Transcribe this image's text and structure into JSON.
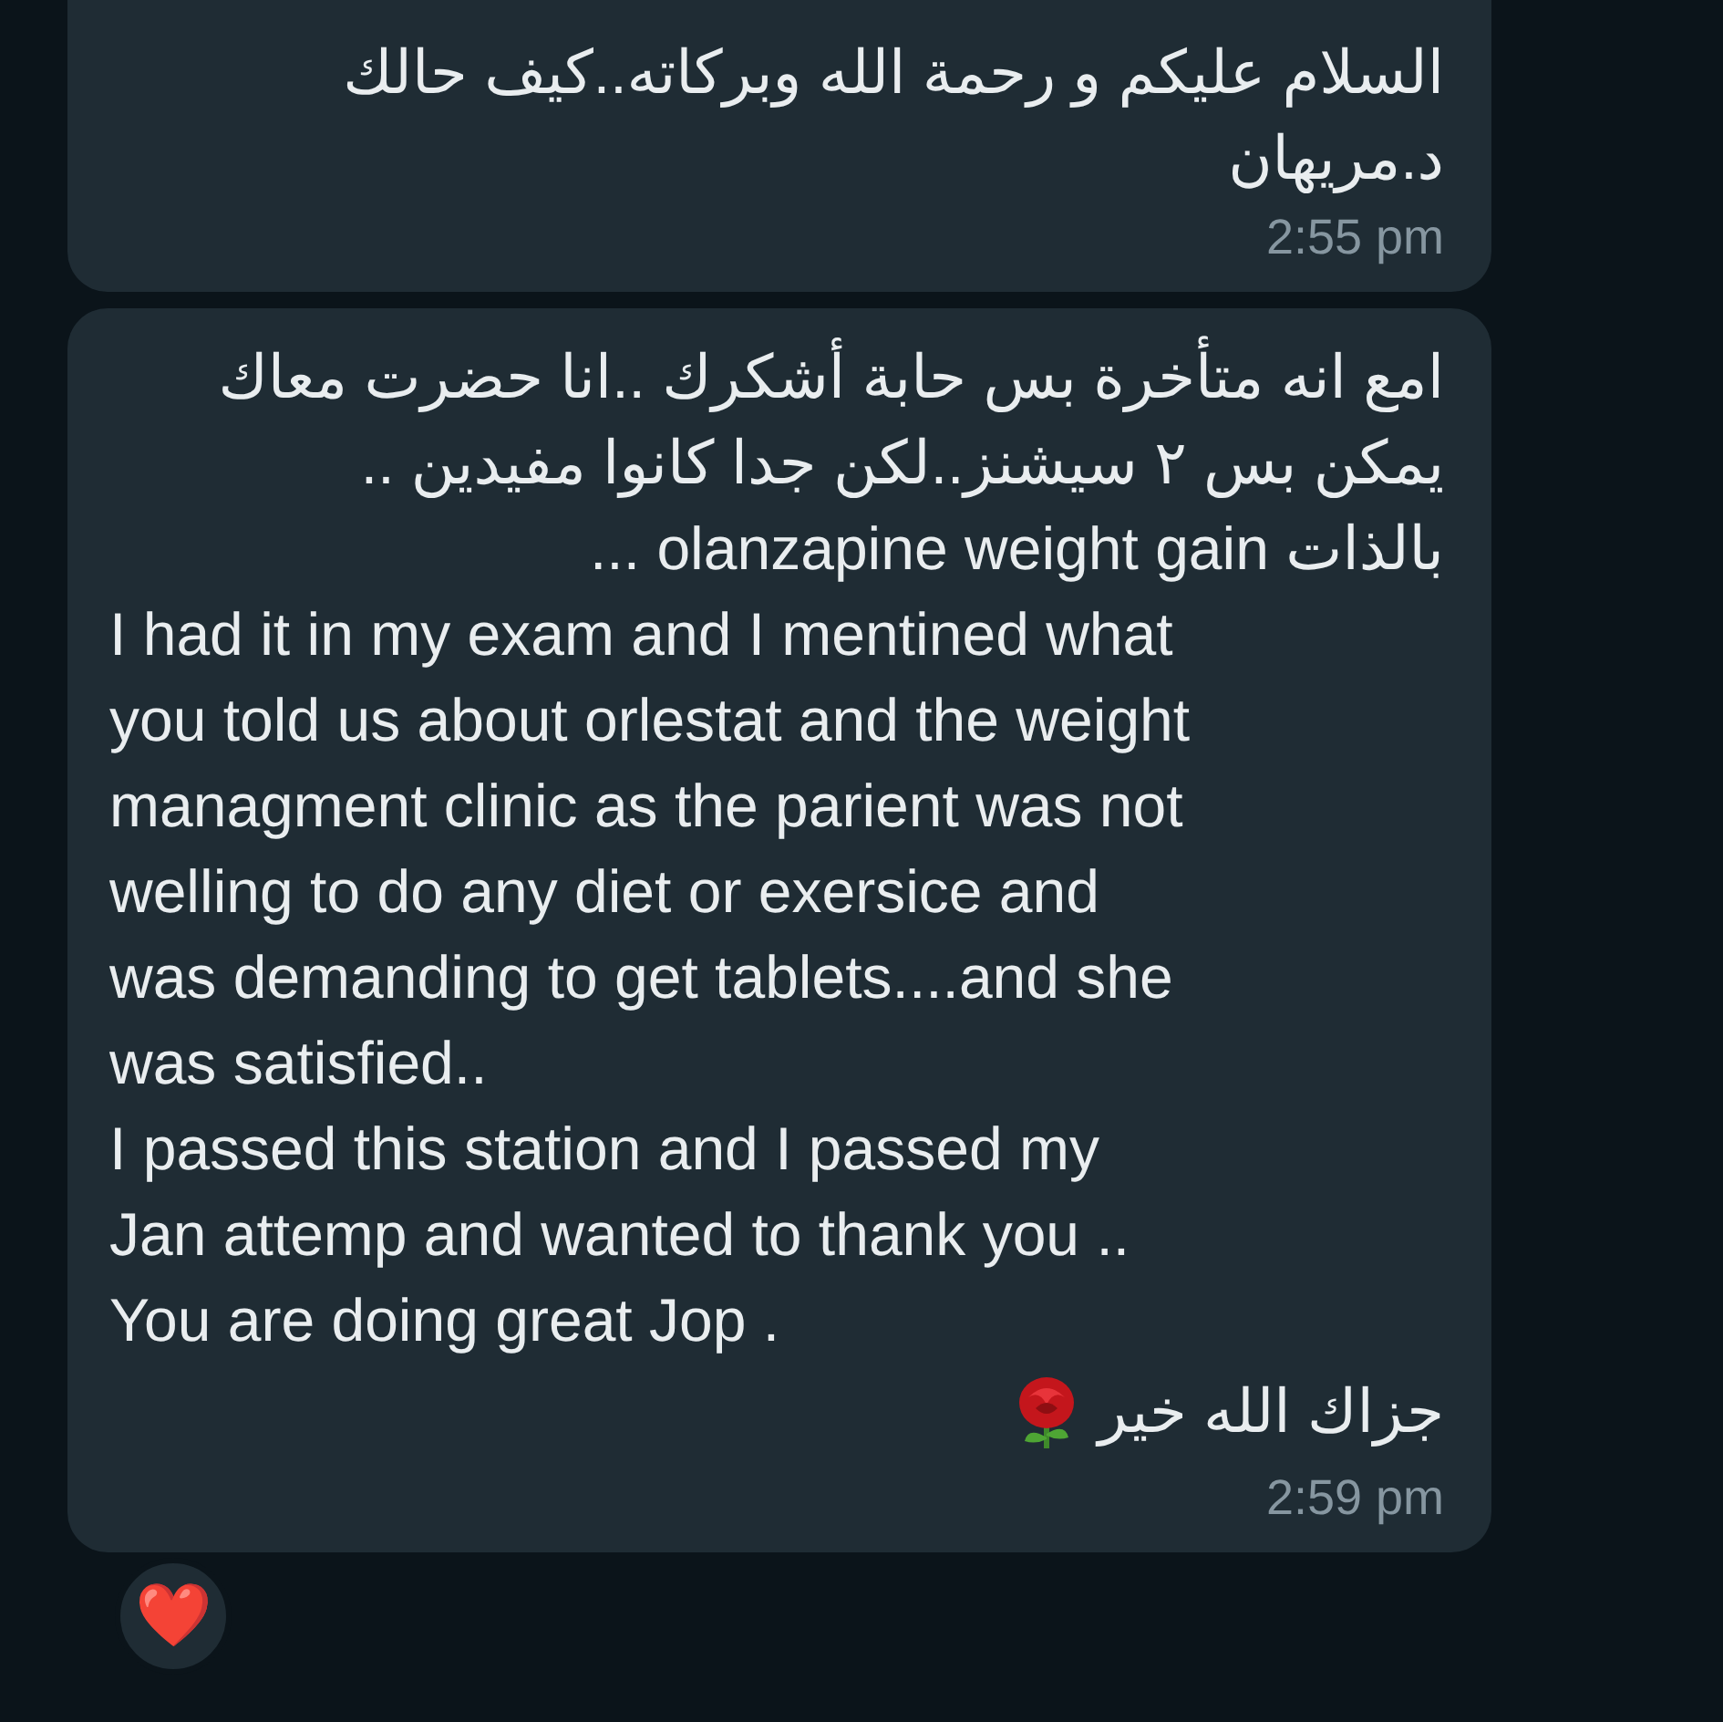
{
  "messages": [
    {
      "lines": [
        "السلام عليكم و رحمة الله وبركاته..كيف حالك",
        "د.مريهان"
      ],
      "time": "2:55 pm"
    },
    {
      "lines": [
        "امع انه متأخرة بس حابة أشكرك ..انا حضرت معاك",
        "يمكن بس ٢ سيشنز..لكن جدا كانوا مفيدين ..",
        "بالذات olanzapine weight gain ...",
        "I had it in my exam and I mentined what",
        "you told us about orlestat and the weight",
        "managment clinic as the parient was not",
        "welling to do any diet or exersice and",
        "was demanding to get tablets....and she",
        "was satisfied..",
        "I passed this station and I passed my",
        "Jan attemp and wanted to thank you ..",
        "You are doing great Jop ."
      ],
      "closing": "جزاك الله خير",
      "time": "2:59 pm",
      "reaction": "❤️"
    }
  ]
}
